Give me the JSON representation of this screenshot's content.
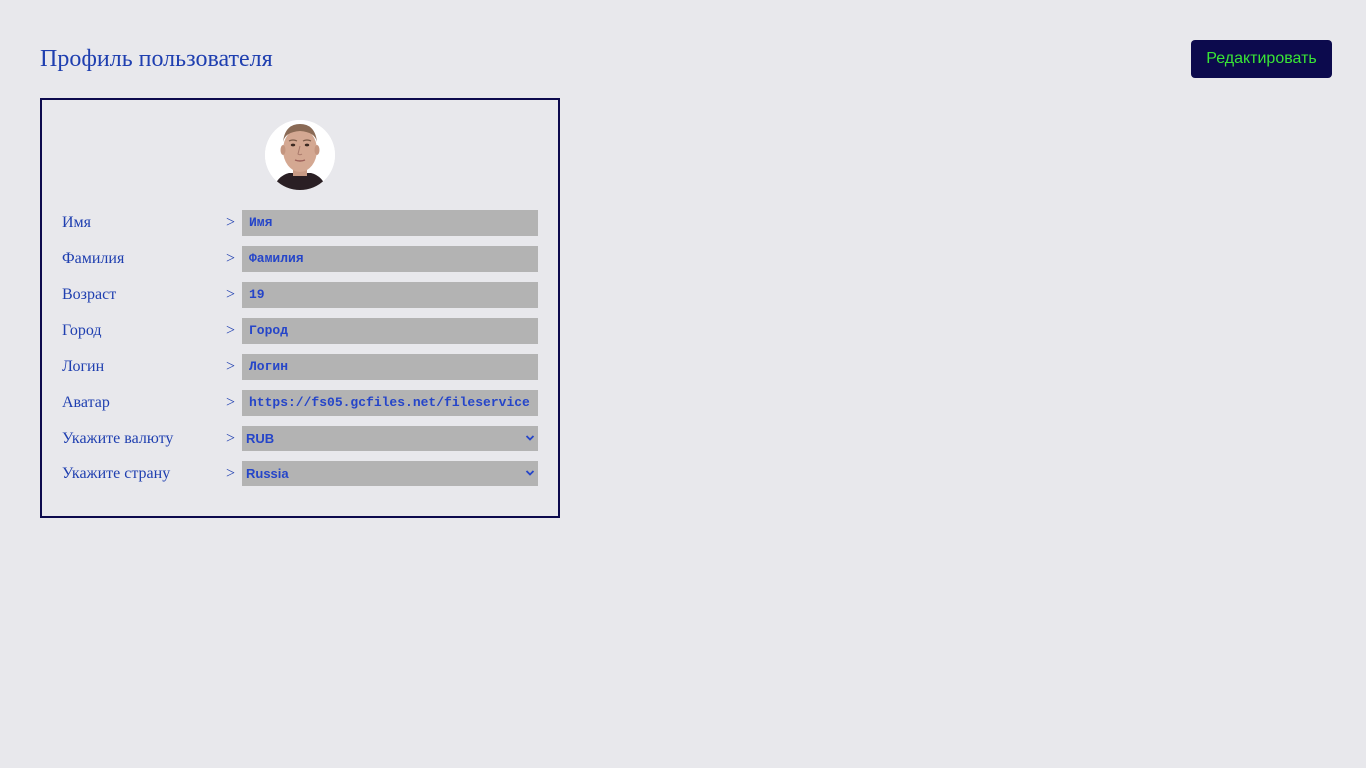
{
  "header": {
    "title": "Профиль пользователя",
    "edit_label": "Редактировать"
  },
  "profile": {
    "avatar_alt": "avatar",
    "fields": [
      {
        "label": "Имя",
        "arrow": ">",
        "value": "Имя"
      },
      {
        "label": "Фамилия",
        "arrow": ">",
        "value": "Фамилия"
      },
      {
        "label": "Возраст",
        "arrow": ">",
        "value": "19"
      },
      {
        "label": "Город",
        "arrow": ">",
        "value": "Город"
      },
      {
        "label": "Логин",
        "arrow": ">",
        "value": "Логин"
      },
      {
        "label": "Аватар",
        "arrow": ">",
        "value": "https://fs05.gcfiles.net/fileservice"
      }
    ],
    "selects": [
      {
        "label": "Укажите валюту",
        "arrow": ">",
        "value": "RUB"
      },
      {
        "label": "Укажите страну",
        "arrow": ">",
        "value": "Russia"
      }
    ]
  },
  "colors": {
    "background": "#e8e8ec",
    "accent_text": "#1f3fb0",
    "button_bg": "#0c0a4d",
    "button_text": "#39e635",
    "input_bg": "#b3b3b3",
    "input_text": "#2545c9"
  }
}
